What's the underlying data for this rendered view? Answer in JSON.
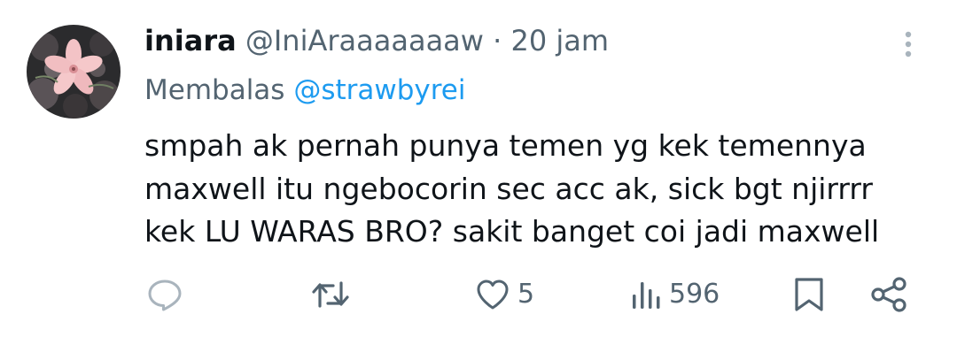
{
  "tweet": {
    "display_name": "iniara",
    "handle": "@IniAraaaaaaaw",
    "separator": "·",
    "time": "20 jam",
    "replying_prefix": "Membalas",
    "replying_to": "@strawbyrei",
    "lines": [
      "smpah ak pernah punya temen yg kek temennya",
      "maxwell itu ngebocorin sec acc ak, sick bgt njirrrr",
      "kek LU WARAS BRO? sakit banget coi jadi maxwell"
    ]
  },
  "actions": {
    "reply_icon": "reply-icon",
    "retweet_icon": "retweet-icon",
    "like_icon": "heart-icon",
    "like_count": "5",
    "views_icon": "views-icon",
    "view_count": "596",
    "bookmark_icon": "bookmark-icon",
    "share_icon": "share-icon"
  },
  "colors": {
    "text": "#0f1419",
    "secondary": "#536471",
    "accent": "#1d9bf0",
    "background": "#ffffff"
  }
}
